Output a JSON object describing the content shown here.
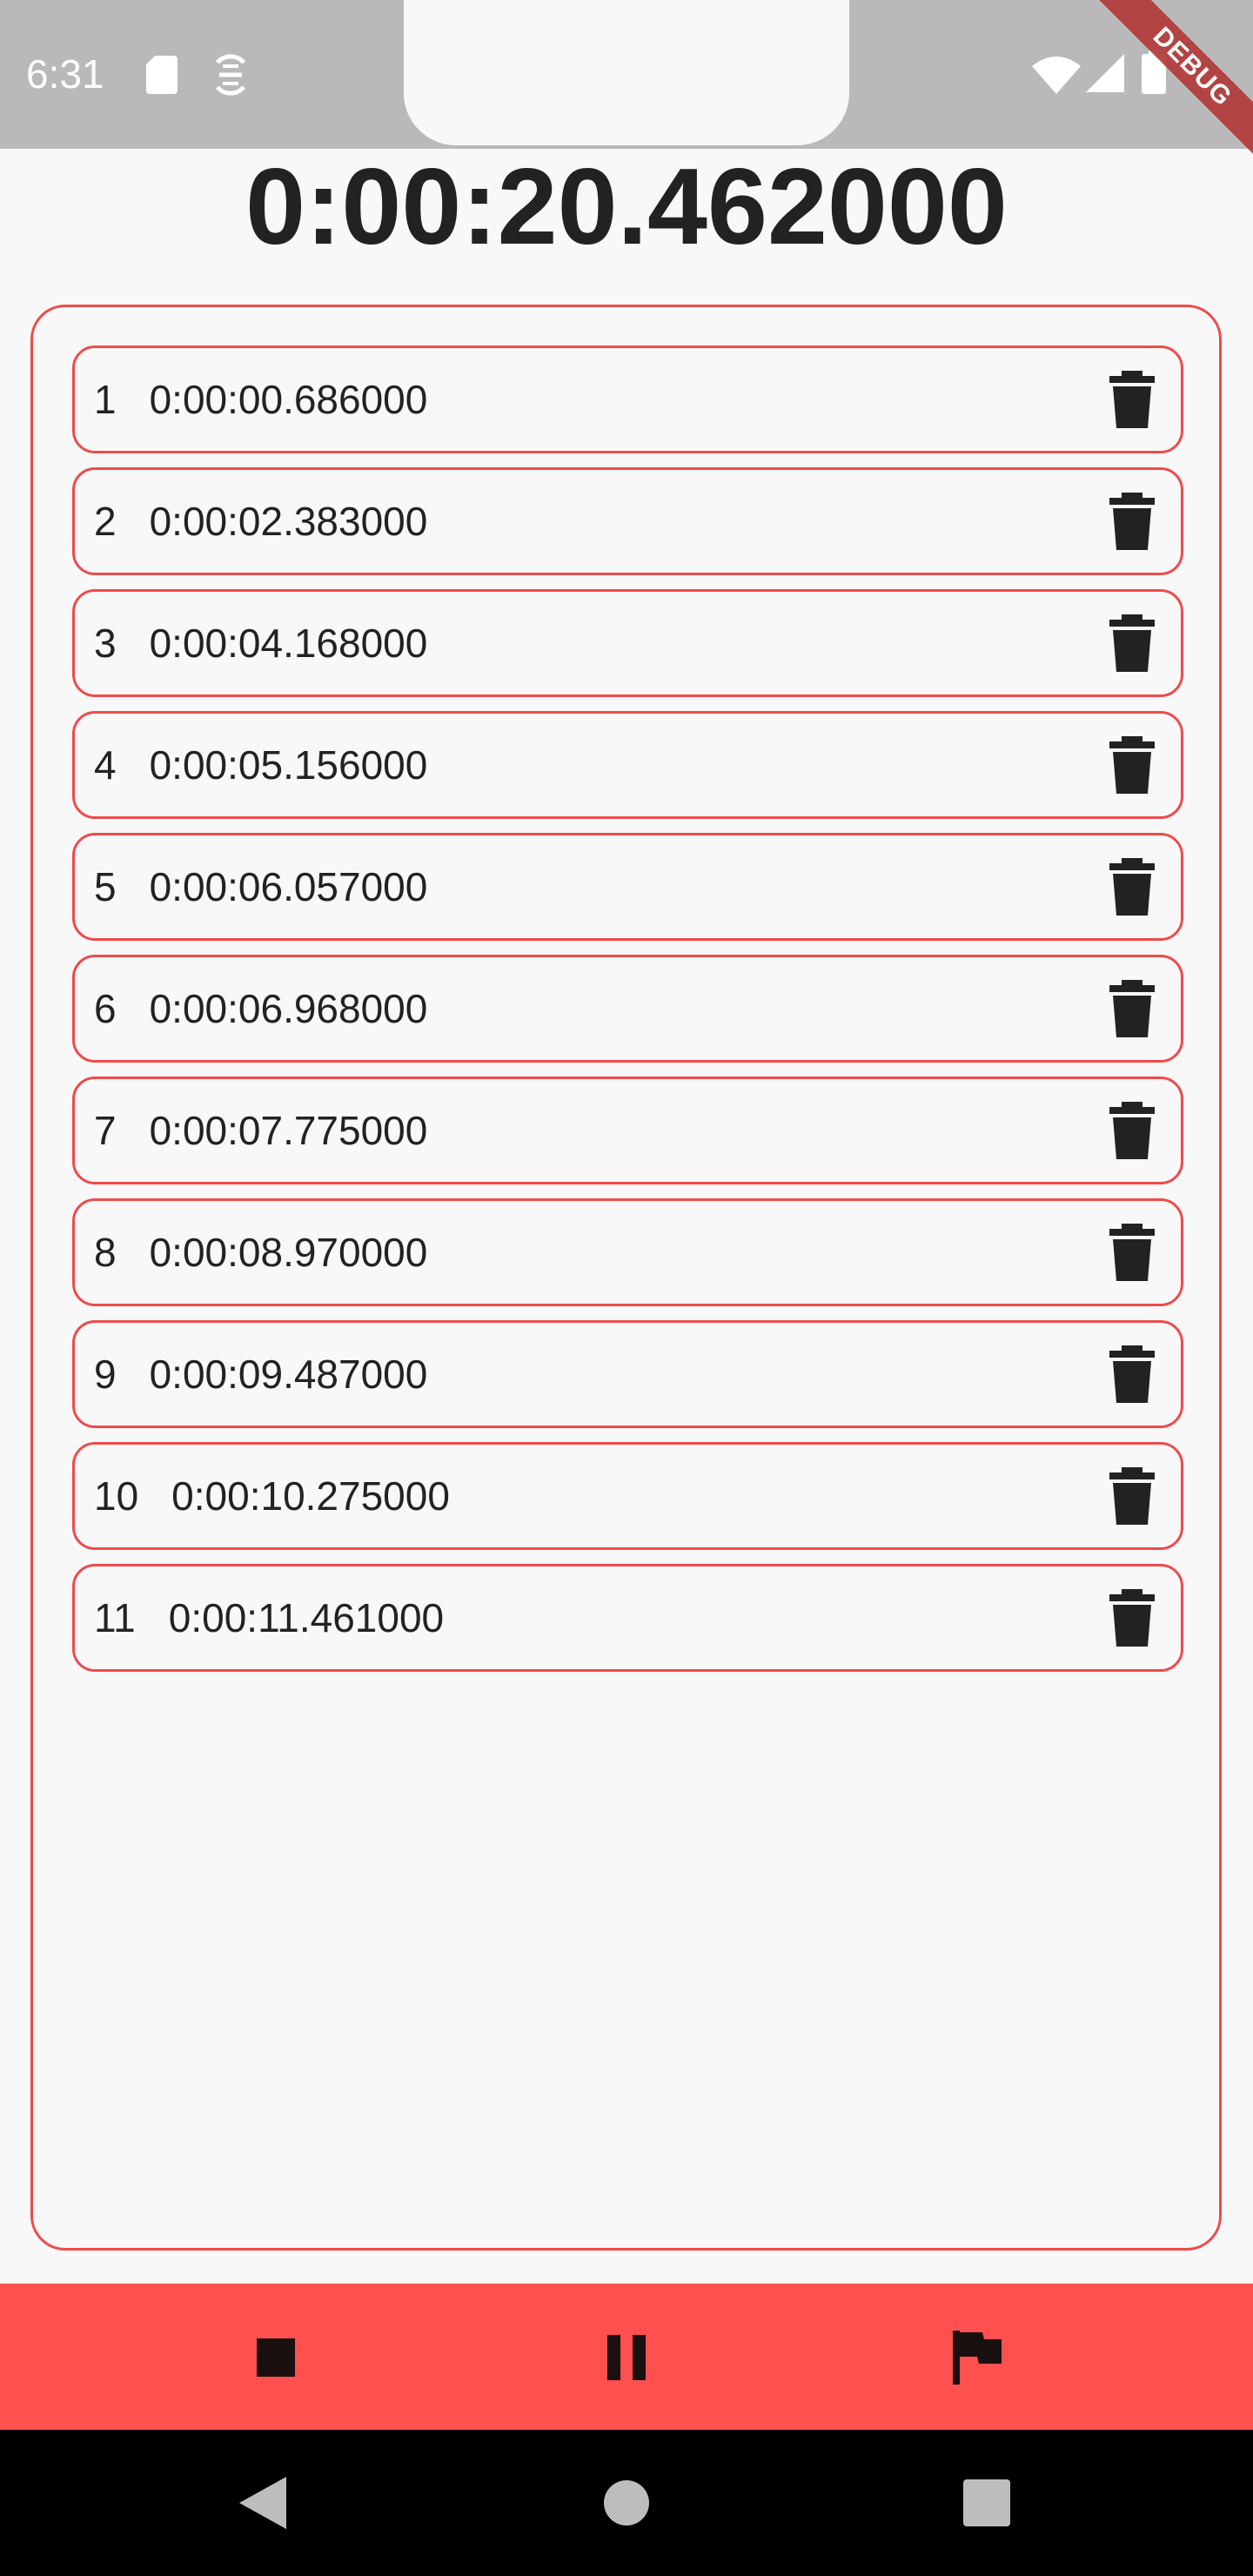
{
  "status_bar": {
    "time": "6:31",
    "debug_label": "DEBUG"
  },
  "stopwatch": {
    "elapsed": "0:00:20.462000"
  },
  "laps": [
    {
      "index": "1",
      "time": "0:00:00.686000"
    },
    {
      "index": "2",
      "time": "0:00:02.383000"
    },
    {
      "index": "3",
      "time": "0:00:04.168000"
    },
    {
      "index": "4",
      "time": "0:00:05.156000"
    },
    {
      "index": "5",
      "time": "0:00:06.057000"
    },
    {
      "index": "6",
      "time": "0:00:06.968000"
    },
    {
      "index": "7",
      "time": "0:00:07.775000"
    },
    {
      "index": "8",
      "time": "0:00:08.970000"
    },
    {
      "index": "9",
      "time": "0:00:09.487000"
    },
    {
      "index": "10",
      "time": "0:00:10.275000"
    },
    {
      "index": "11",
      "time": "0:00:11.461000"
    }
  ],
  "controls": {
    "icons": [
      "stop-icon",
      "pause-icon",
      "flag-icon"
    ]
  },
  "navigation": {
    "icons": [
      "back-icon",
      "home-icon",
      "recents-icon"
    ]
  },
  "colors": {
    "accent": "#ff5050",
    "border": "#ef4b4b",
    "status_bar": "#b9b9b9",
    "text": "#222222",
    "background": "#f8f8f8"
  }
}
